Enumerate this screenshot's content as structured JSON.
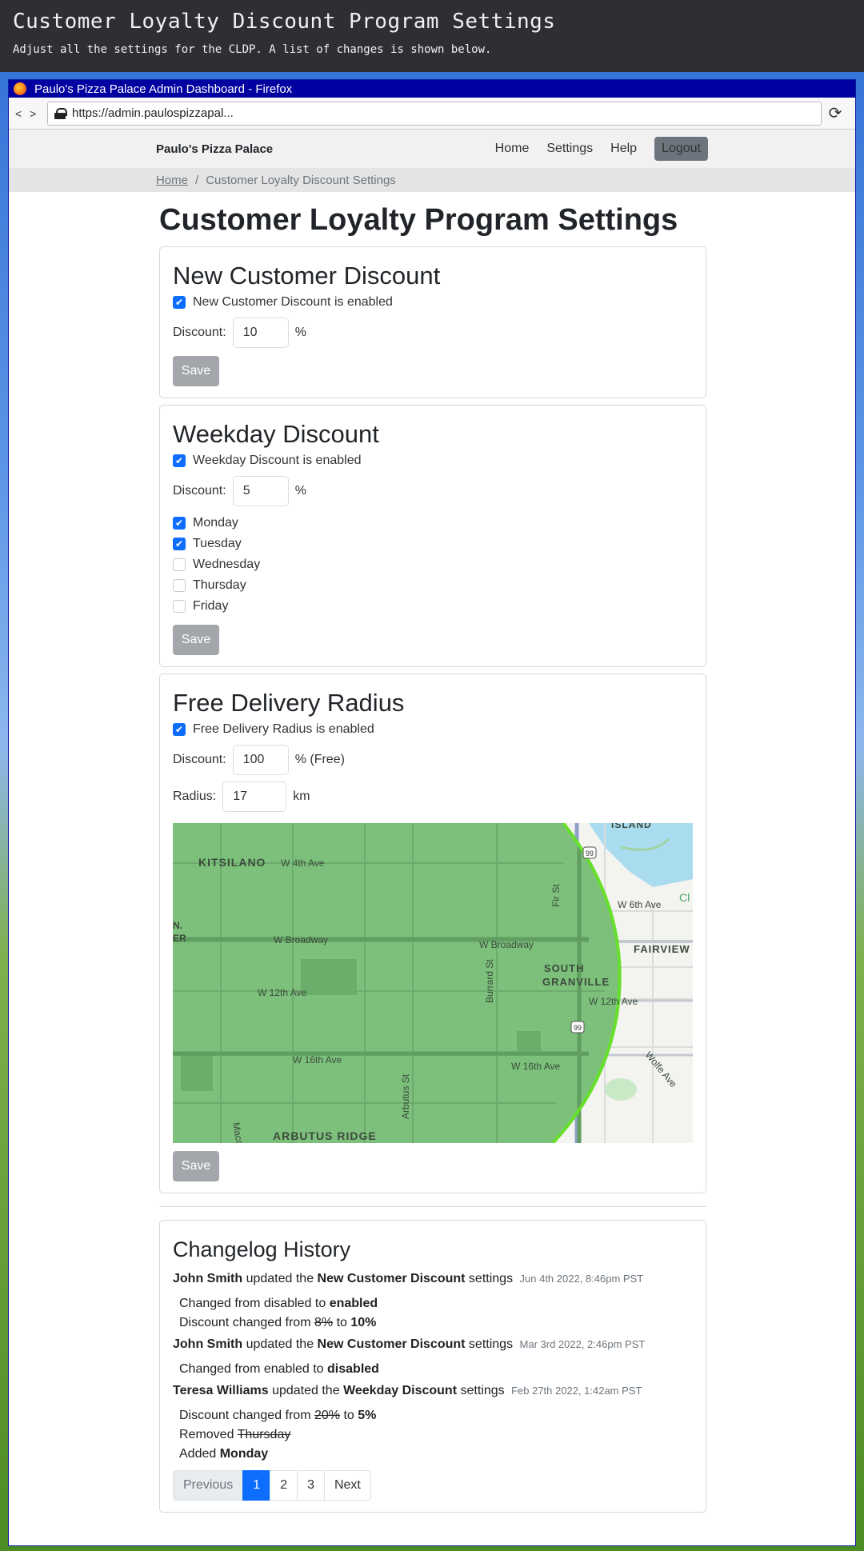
{
  "banner": {
    "title": "Customer Loyalty Discount Program Settings",
    "subtitle": "Adjust all the settings for the CLDP. A list of changes is shown below."
  },
  "browser": {
    "window_title": "Paulo's Pizza Palace Admin Dashboard - Firefox",
    "nav_arrows": "< >",
    "url": "https://admin.paulospizzapal..."
  },
  "site": {
    "brand": "Paulo's Pizza Palace",
    "nav": {
      "home": "Home",
      "settings": "Settings",
      "help": "Help",
      "logout": "Logout"
    },
    "breadcrumb": {
      "home": "Home",
      "separator": "/",
      "current": "Customer Loyalty Discount Settings"
    }
  },
  "page": {
    "title": "Customer Loyalty Program Settings"
  },
  "new_customer": {
    "heading": "New Customer Discount",
    "enabled_label": "New Customer Discount is enabled",
    "enabled": true,
    "discount_label": "Discount:",
    "discount_value": "10",
    "unit": "%",
    "save": "Save"
  },
  "weekday": {
    "heading": "Weekday Discount",
    "enabled_label": "Weekday Discount is enabled",
    "enabled": true,
    "discount_label": "Discount:",
    "discount_value": "5",
    "unit": "%",
    "days": [
      {
        "label": "Monday",
        "checked": true
      },
      {
        "label": "Tuesday",
        "checked": true
      },
      {
        "label": "Wednesday",
        "checked": false
      },
      {
        "label": "Thursday",
        "checked": false
      },
      {
        "label": "Friday",
        "checked": false
      }
    ],
    "save": "Save"
  },
  "delivery": {
    "heading": "Free Delivery Radius",
    "enabled_label": "Free Delivery Radius is enabled",
    "enabled": true,
    "discount_label": "Discount:",
    "discount_value": "100",
    "discount_unit": "% (Free)",
    "radius_label": "Radius:",
    "radius_value": "17",
    "radius_unit": "km",
    "map": {
      "labels": [
        "ISLAND",
        "KITSILANO",
        "W 4th Ave",
        "W 6th Ave",
        "N.",
        "ER",
        "W Broadway",
        "W Broadway",
        "FAIRVIEW",
        "SOUTH",
        "GRANVILLE",
        "W 12th Ave",
        "W 12th Ave",
        "W 16th Ave",
        "W 16th Ave",
        "Burrard St",
        "Fir St",
        "Macdonald St",
        "Arbutus St",
        "Wolfe Ave",
        "ARBUTUS RIDGE",
        "Cl"
      ],
      "shields": [
        "99",
        "99"
      ]
    },
    "save": "Save"
  },
  "changelog": {
    "heading": "Changelog History",
    "entries": [
      {
        "user": "John Smith",
        "verb": "updated the",
        "setting": "New Customer Discount",
        "suffix": "settings",
        "time": "Jun 4th 2022, 8:46pm PST",
        "line1_prefix": "Changed from disabled to",
        "line1_value": "enabled",
        "line2_prefix": "Discount changed from",
        "line2_old": "8%",
        "line2_mid": "to",
        "line2_new": "10%"
      },
      {
        "user": "John Smith",
        "verb": "updated the",
        "setting": "New Customer Discount",
        "suffix": "settings",
        "time": "Mar 3rd 2022, 2:46pm PST",
        "line1_prefix": "Changed from enabled to",
        "line1_value": "disabled"
      },
      {
        "user": "Teresa Williams",
        "verb": "updated the",
        "setting": "Weekday Discount",
        "suffix": "settings",
        "time": "Feb 27th 2022, 1:42am PST",
        "line1_prefix": "Discount changed from",
        "line1_old": "20%",
        "line1_mid": "to",
        "line1_new": "5%",
        "line2_prefix": "Removed",
        "line2_value": "Thursday",
        "line3_prefix": "Added",
        "line3_value": "Monday"
      }
    ],
    "pagination": {
      "previous": "Previous",
      "pages": [
        "1",
        "2",
        "3"
      ],
      "current": "1",
      "next": "Next"
    }
  },
  "colors": {
    "accent": "#0d6efd",
    "radius_fill": "#7cc07c",
    "radius_edge": "#66e02a",
    "save_button": "#a3a6ab",
    "logout_button": "#6c757d"
  }
}
